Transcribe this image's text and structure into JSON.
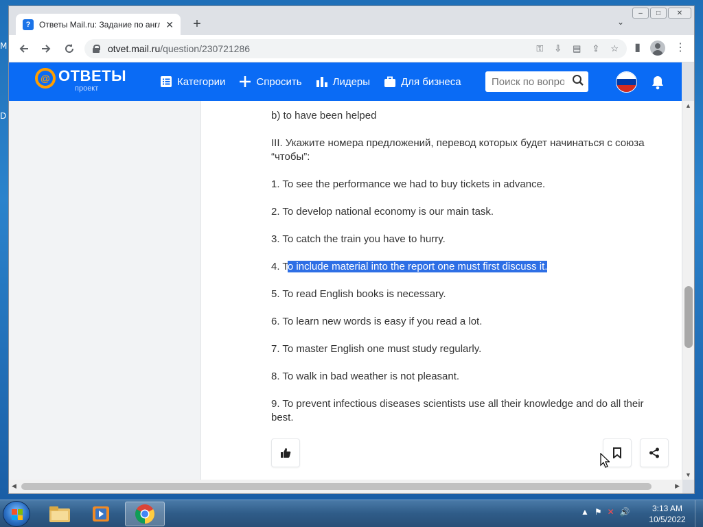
{
  "desktop": {
    "fragment_1": "M",
    "fragment_2": "D"
  },
  "browser": {
    "tab_title": "Ответы Mail.ru: Задание по англ",
    "favicon_text": "?",
    "url_host": "otvet.mail.ru",
    "url_path": "/question/230721286",
    "window_controls": [
      "–",
      "□",
      "✕"
    ]
  },
  "site": {
    "logo_name": "ОТВЕТЫ",
    "logo_sub": "проект",
    "nav": [
      "Категории",
      "Спросить",
      "Лидеры",
      "Для бизнеса"
    ],
    "search_placeholder": "Поиск по вопросам"
  },
  "content": {
    "lines": [
      "b) to have been helped",
      "III. Укажите номера предложений, перевод которых будет начинаться с союза “чтобы”:",
      "1. To see the performance we had to buy tickets in advance.",
      "2. To develop national economy is our main task.",
      "3. To catch the train you have to hurry.",
      "5. To read English books is necessary.",
      "6. To learn new words is easy if you read a lot.",
      "7. To master English one must study regularly.",
      "8. To walk in bad weather is not pleasant.",
      "9. To prevent infectious diseases scientists use all their knowledge and do all their best."
    ],
    "line4_prefix": "4. T",
    "line4_selected": "o include material into the report one must first discuss it."
  },
  "taskbar": {
    "time": "3:13 AM",
    "date": "10/5/2022"
  }
}
